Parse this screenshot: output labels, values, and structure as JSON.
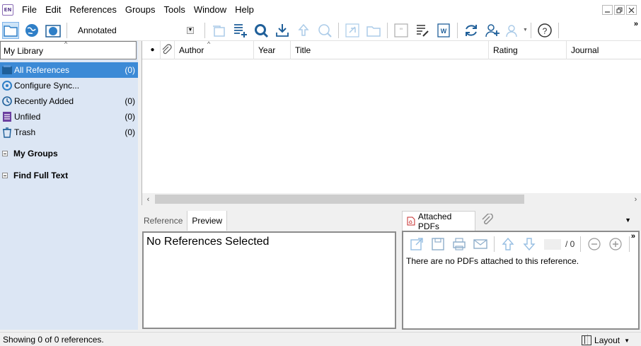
{
  "app": {
    "icon_text": "EN"
  },
  "menu": [
    "File",
    "Edit",
    "References",
    "Groups",
    "Tools",
    "Window",
    "Help"
  ],
  "window_controls": [
    "minimize-icon",
    "restore-icon",
    "close-icon"
  ],
  "toolbar": {
    "output_style": "Annotated",
    "icons": [
      "local-library-icon",
      "online-search-icon",
      "integrated-library-icon",
      "copy-to-group-icon",
      "new-reference-icon",
      "online-search-globe-icon",
      "import-icon",
      "export-icon",
      "find-full-text-icon",
      "open-link-icon",
      "open-file-icon",
      "insert-citation-icon",
      "format-paper-icon",
      "word-icon",
      "sync-icon",
      "share-library-icon",
      "sharing-icon",
      "help-icon"
    ],
    "overflow": "»"
  },
  "left_pane": {
    "header": "My Library",
    "sort_caret": "^",
    "groups": [
      {
        "label": "All References",
        "count": "(0)",
        "icon": "all-references-icon",
        "selected": true
      },
      {
        "label": "Configure Sync...",
        "count": "",
        "icon": "sync-icon",
        "selected": false
      },
      {
        "label": "Recently Added",
        "count": "(0)",
        "icon": "recently-added-icon",
        "selected": false
      },
      {
        "label": "Unfiled",
        "count": "(0)",
        "icon": "unfiled-icon",
        "selected": false
      },
      {
        "label": "Trash",
        "count": "(0)",
        "icon": "trash-icon",
        "selected": false
      }
    ],
    "sections": [
      "My Groups",
      "Find Full Text"
    ]
  },
  "ref_list": {
    "columns": [
      "●",
      "📎",
      "Author",
      "Year",
      "Title",
      "Rating",
      "Journal"
    ],
    "sort_caret": "^"
  },
  "ref_panel": {
    "tabs": [
      "Reference",
      "Preview"
    ],
    "active_tab": "Preview",
    "preview_text": "No References Selected"
  },
  "pdf_panel": {
    "tab_label": "Attached PDFs",
    "page_count": "/ 0",
    "message": "There are no PDFs attached to this reference.",
    "overflow": "»",
    "menu_arrow": "▼"
  },
  "status": {
    "text": "Showing 0 of 0 references.",
    "layout_label": "Layout",
    "layout_chevron": "▼"
  },
  "colors": {
    "selection": "#3c8ad6",
    "left_pane_bg": "#dce6f4",
    "accent": "#2f7fc7"
  }
}
